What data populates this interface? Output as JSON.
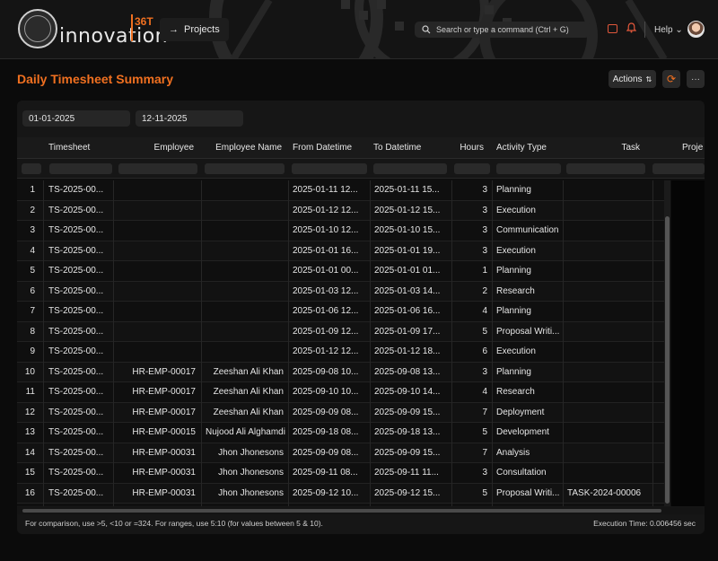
{
  "nav": {
    "brand_text": "innovation",
    "brand_sup": "36T",
    "projects_label": "Projects",
    "search_placeholder": "Search or type a command (Ctrl + G)",
    "help_label": "Help"
  },
  "page": {
    "title": "Daily Timesheet Summary",
    "actions_label": "Actions"
  },
  "filters": {
    "from_date": "01-01-2025",
    "to_date": "12-11-2025"
  },
  "table": {
    "columns": [
      "Timesheet",
      "Employee",
      "Employee Name",
      "From Datetime",
      "To Datetime",
      "Hours",
      "Activity Type",
      "Task",
      "Proje"
    ],
    "rows": [
      {
        "no": "1",
        "timesheet": "TS-2025-00...",
        "employee": "",
        "employee_name": "",
        "from": "2025-01-11 12...",
        "to": "2025-01-11 15...",
        "hours": "3",
        "activity": "Planning",
        "task": ""
      },
      {
        "no": "2",
        "timesheet": "TS-2025-00...",
        "employee": "",
        "employee_name": "",
        "from": "2025-01-12 12...",
        "to": "2025-01-12 15...",
        "hours": "3",
        "activity": "Execution",
        "task": ""
      },
      {
        "no": "3",
        "timesheet": "TS-2025-00...",
        "employee": "",
        "employee_name": "",
        "from": "2025-01-10 12...",
        "to": "2025-01-10 15...",
        "hours": "3",
        "activity": "Communication",
        "task": ""
      },
      {
        "no": "4",
        "timesheet": "TS-2025-00...",
        "employee": "",
        "employee_name": "",
        "from": "2025-01-01 16...",
        "to": "2025-01-01 19...",
        "hours": "3",
        "activity": "Execution",
        "task": ""
      },
      {
        "no": "5",
        "timesheet": "TS-2025-00...",
        "employee": "",
        "employee_name": "",
        "from": "2025-01-01 00...",
        "to": "2025-01-01 01...",
        "hours": "1",
        "activity": "Planning",
        "task": ""
      },
      {
        "no": "6",
        "timesheet": "TS-2025-00...",
        "employee": "",
        "employee_name": "",
        "from": "2025-01-03 12...",
        "to": "2025-01-03 14...",
        "hours": "2",
        "activity": "Research",
        "task": ""
      },
      {
        "no": "7",
        "timesheet": "TS-2025-00...",
        "employee": "",
        "employee_name": "",
        "from": "2025-01-06 12...",
        "to": "2025-01-06 16...",
        "hours": "4",
        "activity": "Planning",
        "task": ""
      },
      {
        "no": "8",
        "timesheet": "TS-2025-00...",
        "employee": "",
        "employee_name": "",
        "from": "2025-01-09 12...",
        "to": "2025-01-09 17...",
        "hours": "5",
        "activity": "Proposal Writi...",
        "task": ""
      },
      {
        "no": "9",
        "timesheet": "TS-2025-00...",
        "employee": "",
        "employee_name": "",
        "from": "2025-01-12 12...",
        "to": "2025-01-12 18...",
        "hours": "6",
        "activity": "Execution",
        "task": ""
      },
      {
        "no": "10",
        "timesheet": "TS-2025-00...",
        "employee": "HR-EMP-00017",
        "employee_name": "Zeeshan Ali Khan",
        "from": "2025-09-08 10...",
        "to": "2025-09-08 13...",
        "hours": "3",
        "activity": "Planning",
        "task": ""
      },
      {
        "no": "11",
        "timesheet": "TS-2025-00...",
        "employee": "HR-EMP-00017",
        "employee_name": "Zeeshan Ali Khan",
        "from": "2025-09-10 10...",
        "to": "2025-09-10 14...",
        "hours": "4",
        "activity": "Research",
        "task": ""
      },
      {
        "no": "12",
        "timesheet": "TS-2025-00...",
        "employee": "HR-EMP-00017",
        "employee_name": "Zeeshan Ali Khan",
        "from": "2025-09-09 08...",
        "to": "2025-09-09 15...",
        "hours": "7",
        "activity": "Deployment",
        "task": ""
      },
      {
        "no": "13",
        "timesheet": "TS-2025-00...",
        "employee": "HR-EMP-00015",
        "employee_name": "Nujood Ali Alghamdi",
        "from": "2025-09-18 08...",
        "to": "2025-09-18 13...",
        "hours": "5",
        "activity": "Development",
        "task": ""
      },
      {
        "no": "14",
        "timesheet": "TS-2025-00...",
        "employee": "HR-EMP-00031",
        "employee_name": "Jhon Jhonesons",
        "from": "2025-09-09 08...",
        "to": "2025-09-09 15...",
        "hours": "7",
        "activity": "Analysis",
        "task": ""
      },
      {
        "no": "15",
        "timesheet": "TS-2025-00...",
        "employee": "HR-EMP-00031",
        "employee_name": "Jhon Jhonesons",
        "from": "2025-09-11 08...",
        "to": "2025-09-11 11...",
        "hours": "3",
        "activity": "Consultation",
        "task": ""
      },
      {
        "no": "16",
        "timesheet": "TS-2025-00...",
        "employee": "HR-EMP-00031",
        "employee_name": "Jhon Jhonesons",
        "from": "2025-09-12 10...",
        "to": "2025-09-12 15...",
        "hours": "5",
        "activity": "Proposal Writi...",
        "task": "TASK-2024-00006"
      }
    ]
  },
  "footer": {
    "note": "For comparison, use >5, <10 or =324. For ranges, use 5:10 (for values between 5 & 10).",
    "execution_time": "Execution Time: 0.006456 sec"
  },
  "colors": {
    "accent": "#f07020",
    "icon_red": "#e0573b",
    "background": "#0b0b0b"
  }
}
